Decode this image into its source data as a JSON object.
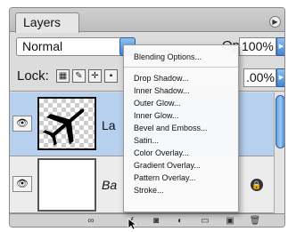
{
  "panel": {
    "tab_label": "Layers",
    "blend_mode": "Normal",
    "opacity_label": "Opacity:",
    "opacity_value": "100%",
    "lock_label": "Lock:",
    "fill_value": ".00%"
  },
  "layers": [
    {
      "name": "La",
      "selected": true,
      "thumbnail": "airplane-icon"
    },
    {
      "name": "Ba",
      "selected": false,
      "thumbnail": "white"
    }
  ],
  "context_menu": {
    "header": "Blending Options...",
    "items": [
      "Drop Shadow...",
      "Inner Shadow...",
      "Outer Glow...",
      "Inner Glow...",
      "Bevel and Emboss...",
      "Satin...",
      "Color Overlay...",
      "Gradient Overlay...",
      "Pattern Overlay...",
      "Stroke..."
    ]
  },
  "icons": {
    "menu": "panel-menu-icon",
    "select_arrow": "dropdown-arrow-icon",
    "visibility": "eye-icon",
    "lock": "lock-icon",
    "trash": "trash-icon"
  },
  "colors": {
    "selection": "#b7d0ee",
    "accent": "#3f86d6"
  }
}
